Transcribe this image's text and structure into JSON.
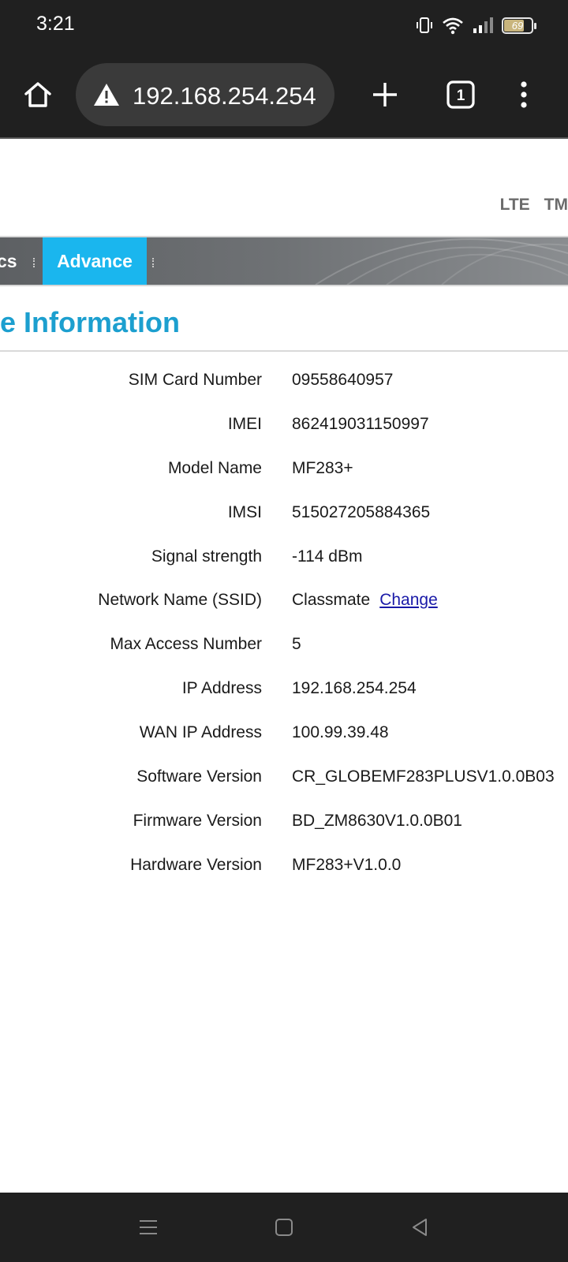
{
  "status_bar": {
    "time": "3:21",
    "battery_level": "69",
    "icons": [
      "vibrate-icon",
      "wifi-icon",
      "signal-icon",
      "battery-icon"
    ]
  },
  "browser": {
    "url": "192.168.254.254",
    "tab_count": "1",
    "icons": [
      "home-icon",
      "warning-icon",
      "new-tab-icon",
      "tab-switcher-icon",
      "overflow-menu-icon"
    ]
  },
  "page": {
    "network_labels": [
      "LTE",
      "TM"
    ],
    "nav": {
      "partial_item": "cs",
      "active_item": "Advance"
    },
    "section_title": "e Information",
    "info_rows": [
      {
        "label": "SIM Card Number",
        "value": "09558640957"
      },
      {
        "label": "IMEI",
        "value": "862419031150997"
      },
      {
        "label": "Model Name",
        "value": "MF283+"
      },
      {
        "label": "IMSI",
        "value": "515027205884365"
      },
      {
        "label": "Signal strength",
        "value": "-114 dBm"
      },
      {
        "label": "Network Name (SSID)",
        "value": "Classmate",
        "link": "Change"
      },
      {
        "label": "Max Access Number",
        "value": "5"
      },
      {
        "label": "IP Address",
        "value": "192.168.254.254"
      },
      {
        "label": "WAN IP Address",
        "value": "100.99.39.48"
      },
      {
        "label": "Software Version",
        "value": "CR_GLOBEMF283PLUSV1.0.0B03"
      },
      {
        "label": "Firmware Version",
        "value": "BD_ZM8630V1.0.0B01"
      },
      {
        "label": "Hardware Version",
        "value": "MF283+V1.0.0"
      }
    ]
  },
  "colors": {
    "accent": "#1c9fcf",
    "active_tab": "#1ab6ee",
    "link": "#1a1aa8",
    "chrome_bg": "#202020"
  },
  "system_nav": {
    "icons": [
      "menu-icon",
      "home-square-icon",
      "back-triangle-icon"
    ]
  }
}
